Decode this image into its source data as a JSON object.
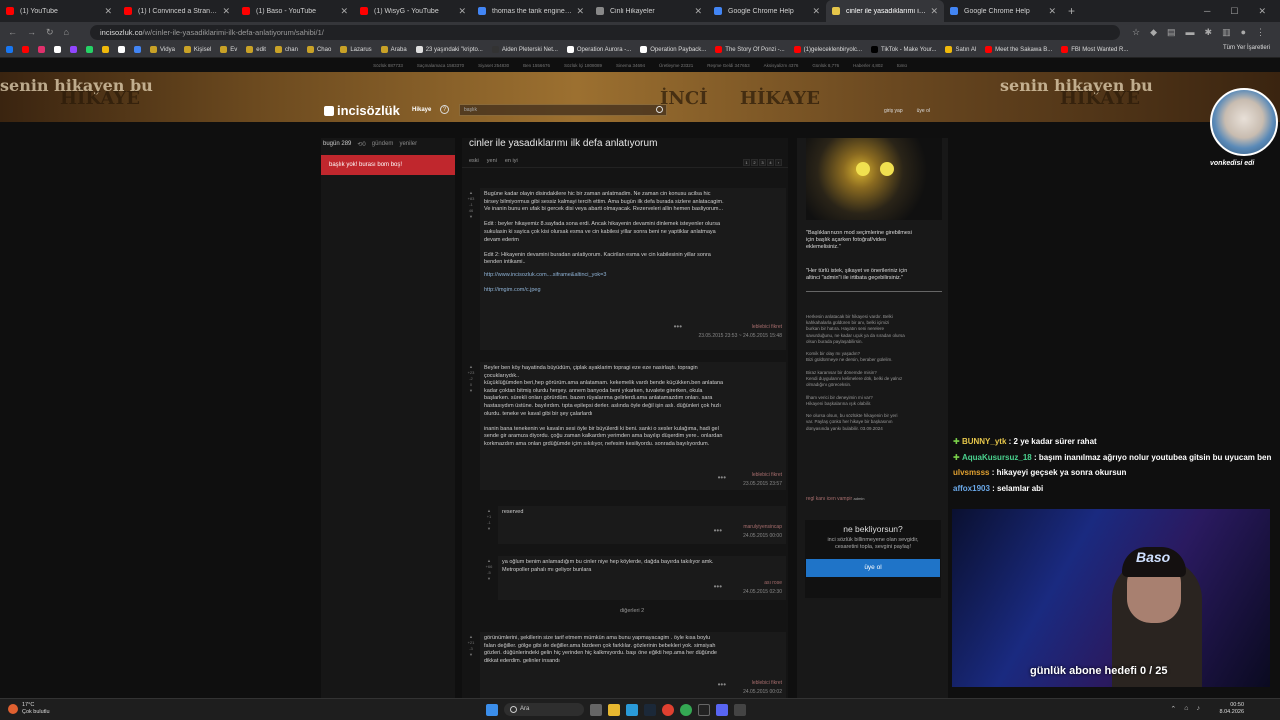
{
  "tabs": [
    {
      "label": "(1) YouTube",
      "color": "#ff0000"
    },
    {
      "label": "(1) I Convinced a Stranger to R",
      "color": "#ff0000"
    },
    {
      "label": "(1) Baso - YouTube",
      "color": "#ff0000"
    },
    {
      "label": "(1) WisyG - YouTube",
      "color": "#ff0000"
    },
    {
      "label": "thomas the tank engine - Goog",
      "color": "#4285f4"
    },
    {
      "label": "Cinli Hikayeler",
      "color": "#888888"
    },
    {
      "label": "Google Chrome Help",
      "color": "#4285f4"
    },
    {
      "label": "cinler ile yasadıklarımı ilk defa",
      "color": "#e6c64a",
      "active": true
    },
    {
      "label": "Google Chrome Help",
      "color": "#4285f4"
    }
  ],
  "address": {
    "domain": "incisozluk.co",
    "path": "/w/cinler-ile-yasadiklarimi-ilk-defa-anlatiyorum/sahibi/1/"
  },
  "bookmarks": [
    {
      "label": "",
      "color": "#1877f2"
    },
    {
      "label": "",
      "color": "#ff0000"
    },
    {
      "label": "",
      "color": "#e1306c"
    },
    {
      "label": "",
      "color": "#ffffff"
    },
    {
      "label": "",
      "color": "#9146ff"
    },
    {
      "label": "",
      "color": "#25d366"
    },
    {
      "label": "",
      "color": "#f0b90b"
    },
    {
      "label": "",
      "color": "#ffffff"
    },
    {
      "label": "",
      "color": "#4285f4"
    },
    {
      "label": "Vidya",
      "color": "#c9a227"
    },
    {
      "label": "Kişisel",
      "color": "#c9a227"
    },
    {
      "label": "Ev",
      "color": "#c9a227"
    },
    {
      "label": "edit",
      "color": "#c9a227"
    },
    {
      "label": "chan",
      "color": "#c9a227"
    },
    {
      "label": "Chao",
      "color": "#c9a227"
    },
    {
      "label": "Lazarus",
      "color": "#c9a227"
    },
    {
      "label": "Araba",
      "color": "#c9a227"
    },
    {
      "label": "23 yaşındaki \"kripto...",
      "color": "#e0e0e0"
    },
    {
      "label": "Aiden Pleterski Net...",
      "color": "#333333"
    },
    {
      "label": "Operation Aurora -...",
      "color": "#ffffff"
    },
    {
      "label": "Operation Payback...",
      "color": "#ffffff"
    },
    {
      "label": "The Story Of Ponzi -...",
      "color": "#ff0000"
    },
    {
      "label": "(1)geleceklenbiryolc...",
      "color": "#ff0000"
    },
    {
      "label": "TikTok - Make Your...",
      "color": "#000000"
    },
    {
      "label": "Satın Al",
      "color": "#f0b90b"
    },
    {
      "label": "Meet the Sakawa B...",
      "color": "#ff0000"
    },
    {
      "label": "FBI Most Wanted R...",
      "color": "#ff0000"
    }
  ],
  "bookmarks_all": "Tüm Yer İşaretleri",
  "statbar": [
    "Sözlük 887733",
    "Saçmalamaca 1583370",
    "Siyaset 254830",
    "Ben 1556676",
    "Sözlük İçi 1808089",
    "Sinema 34694",
    "Üretleyme 23321",
    "Reşme Geldi 347653",
    "Aksisyalizm 4376",
    "Günlük 8,776",
    "Haberler 4,802",
    "tümü"
  ],
  "banner_words": [
    "senin hikayen bu",
    "HİKAYE",
    "İNCİ",
    "HİKAYE",
    "senin hikayen bu",
    "HİKAYE"
  ],
  "site": {
    "logo": "incisözlük",
    "section": "Hikaye",
    "search_placeholder": "başlık",
    "login": "giriş yap",
    "signup": "üye ol"
  },
  "left": {
    "today": "bugün 289",
    "refresh": "0",
    "gundem": "gündem",
    "yeniler": "yeniler",
    "empty": "başlık yok! burası bom boş!"
  },
  "topic": {
    "title": "cinler ile yasadıklarımı ilk defa anlatıyorum",
    "tabs": [
      "eski",
      "yeni",
      "en iyi"
    ],
    "pages": [
      "1",
      "2",
      "3",
      "4",
      "›"
    ]
  },
  "entries": [
    {
      "votes": "+83\n-1\n46",
      "text": "Bugüne kadar olayin disindakilere hic bir zaman anlatmadim. Ne zaman cin konusu acilsa hic\nbirsey bilmiyormus gibi sessiz kalmayi tercih ettim. Ama bugün ilk defa burada sizlere anlatacagim.\nVe inanin bunu en ufak bi gercek disi veya abarti olmayacak. Rezerveleri allin hemen basliyorum...\n\nEdit : beyler hikayemiz 8.sayfada sona erdi. Ancak hikayenin devamini dinlemek isteyenler olursa\nsukulasin ki sayica çok kisi olursak esma ve cin kabilesi yillar sonra beni ne yaptiklar anlatmaya\ndevam ederim\n\nEdit 2: Hikayenin devamini buradan anlatiyorum. Kacirilan esma ve cin kabilesinin yillar sonra\nbenden intikami..",
      "link1": "http://www.incisozluk.com....siframe&altinci_yok=3",
      "link2": "http://imgim.com/c.jpeg",
      "author": "leblebici fikret",
      "date": "23.05.2015 23:53 ~ 24.05.2015 15:48"
    },
    {
      "votes": "+23\n-2\n0",
      "text": "Beyler ben köy hayatinda büyüdüm, çiplak ayaklarim topragi eze eze nasirlaştı. topragin\nçocuklarıydık..\nküçüklüğümden beri,hep görürüm.ama anlatamam. kekemelik vardı bende küçükken.ben anlatana\nkadar çoktan bitmiş olurdu herşey. annem banyoda beni yıkarken, tuvalete girerken, okula\nbaşlarken. sürekli onları görürdüm. bazen rüyalarıma gelirlerdi.ama anlatamazdım onları. sara\nhastasıydım üstüne. bayılırdım. tıpta epilepsi derler. aslında öyle değil işin aslı. düğünleri çok hızlı\nolurdu. teneke ve kaval gibi bir şey çalarlardı\n\ninanin bana tenekenin ve kavalın sesi öyle bir büyülerdi ki beni. sanki o sesler kulağıma, hadi gel\nsende gir aramıza diyordu. çoğu zaman kalkardım yerimden ama bayılıp düşerdim yere.. onlardan\nkorkmazdım ama onlan grdüğümde içim sıkılıyor, nefesim kesiliyordu. sonrada bayılıyordum.",
      "author": "leblebici fikret",
      "date": "23.05.2015 23:57"
    },
    {
      "votes": "+1\n-1",
      "text": "reserved",
      "author": "marulyiyensincap",
      "date": "24.05.2015 00:00"
    },
    {
      "votes": "+66\n-5",
      "text": "ya oğlum benim anlamadığım bu cinler niye hep köylerde, dağda bayırda takılıyor amk.\nMetropoller pahalı mı geliyor bunlara",
      "author": "ası rose",
      "date": "24.05.2015 02:30"
    },
    {
      "votes": "+21\n-3",
      "text": "görünümlerini, şekillerin size tarif etmem mümkün ama bunu yapmayacagim . öyle kısa boylu\nfalan değiller. gölge gibi de değiller.ama bizdeen çok farklılar. gözlerinin bebekleri yok. simsiyah\ngözleri. düğünlerindeki gelin hiç yerinden hiç kalkmıyordu. başı öne eğikti hep.ama her düğünde\ndikkat ederdim. gelinler insandı",
      "author": "leblebici fikret",
      "date": "24.05.2015 00:02"
    }
  ],
  "others": "diğerleri 2",
  "right": {
    "notice1": "\"Başlıklarınızın mod seçimlerine girebilmesi\niçin başlık açarken fotoğraf/video\neklemelisiniz.\"",
    "notice2": "\"Her türlü istek, şikayet ve önerileriniz için\naltinci \"admin\"i ile irtibata geçebilirsiniz.\"",
    "desc": "Herkesin anlatacak bir hikayesi vardır. Belki\nkahkahalarla güldüren bir anı, belki içimizi\nburkan bir hatıra. Hayatın seni nerelere\nsavurduğunu, ne kadar uçuk ya da sıradan olursa\nolsun burada paylaşabilirsin.\n\nKomik bir olay mı yaşadın?\nBizi güldürmeye ne dersin, beraber gülelim.\n\nBiraz karamsar bir dönemde misin?\nKendi duygularını kelimelere dök, belki de yalnız\nolmadığını göreceksin.\n\nİlham verici bir deneyimin mi var?\nHikayeni başkalarına ışık olabilir.\n\nNe olursa olsun, bu sözlükte hikayenin bir yeri\nvar. Paylaş çünkü her hikaye bir başkasının\ndünyasında yankı bulabilir. 03.09.2024",
    "signature": "regl kanı icen vampir",
    "signature_role": "admin"
  },
  "cta": {
    "question": "ne bekliyorsun?",
    "desc": "inci sözlük billinmeyene olan sevgidir,\ncesaretini topla, sevgini paylaş!",
    "button": "üye ol"
  },
  "stream": {
    "avatar_name": "vonkedisi edi",
    "chat": [
      {
        "user": "BUNNY_ytk",
        "msg": "2 ye kadar sürer rahat",
        "badge": true
      },
      {
        "user": "AquaKusursuz_18",
        "msg": "başım inanılmaz ağrıyo nolur youtubea gitsin bu uyucam ben",
        "badge": true
      },
      {
        "user": "ulvsmsss",
        "msg": "hikayeyi geçsek ya sonra okursun",
        "badge": false
      },
      {
        "user": "affox1903",
        "msg": "selamlar abi",
        "badge": false
      }
    ],
    "goal": "günlük abone hedefi 0 / 25",
    "cam_sign": "Baso"
  },
  "taskbar": {
    "temp": "17°C",
    "weather": "Çok bulutlu",
    "search": "Ara",
    "time": "00:50",
    "date": "8.04.2026"
  }
}
